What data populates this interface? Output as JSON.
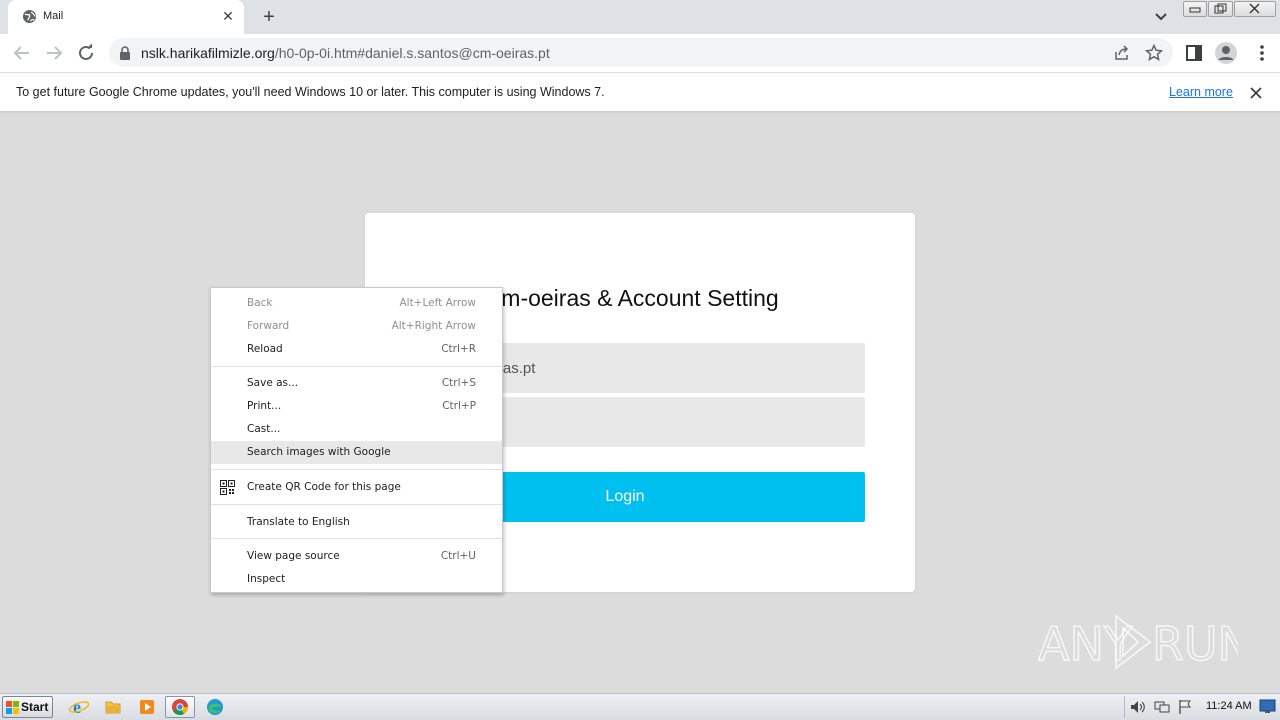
{
  "browser": {
    "tab_title": "Mail",
    "url_host": "nslk.harikafilmizle.org",
    "url_path": "/h0-0p-0i.htm#daniel.s.santos@cm-oeiras.pt"
  },
  "infobar": {
    "message": "To get future Google Chrome updates, you'll need Windows 10 or later. This computer is using Windows 7.",
    "link_label": "Learn more"
  },
  "page": {
    "title": "m-oeiras & Account Setting",
    "email_value": "antos@cm-oeiras.pt",
    "password_value": "l",
    "login_label": "Login",
    "accent_color": "#00c0ef"
  },
  "context_menu": {
    "items": [
      {
        "label": "Back",
        "shortcut": "Alt+Left Arrow",
        "enabled": false
      },
      {
        "label": "Forward",
        "shortcut": "Alt+Right Arrow",
        "enabled": false
      },
      {
        "label": "Reload",
        "shortcut": "Ctrl+R",
        "enabled": true
      },
      {
        "label": "Save as...",
        "shortcut": "Ctrl+S",
        "enabled": true
      },
      {
        "label": "Print...",
        "shortcut": "Ctrl+P",
        "enabled": true
      },
      {
        "label": "Cast...",
        "shortcut": "",
        "enabled": true
      },
      {
        "label": "Search images with Google",
        "shortcut": "",
        "enabled": true,
        "highlighted": true
      },
      {
        "label": "Create QR Code for this page",
        "shortcut": "",
        "enabled": true,
        "icon": "qr-code-icon"
      },
      {
        "label": "Translate to English",
        "shortcut": "",
        "enabled": true
      },
      {
        "label": "View page source",
        "shortcut": "Ctrl+U",
        "enabled": true
      },
      {
        "label": "Inspect",
        "shortcut": "",
        "enabled": true
      }
    ]
  },
  "watermark": {
    "text": "ANY RUN"
  },
  "taskbar": {
    "start_label": "Start",
    "clock": "11:24 AM",
    "apps": [
      "internet-explorer-icon",
      "file-explorer-icon",
      "media-player-icon",
      "chrome-icon",
      "edge-icon"
    ]
  }
}
